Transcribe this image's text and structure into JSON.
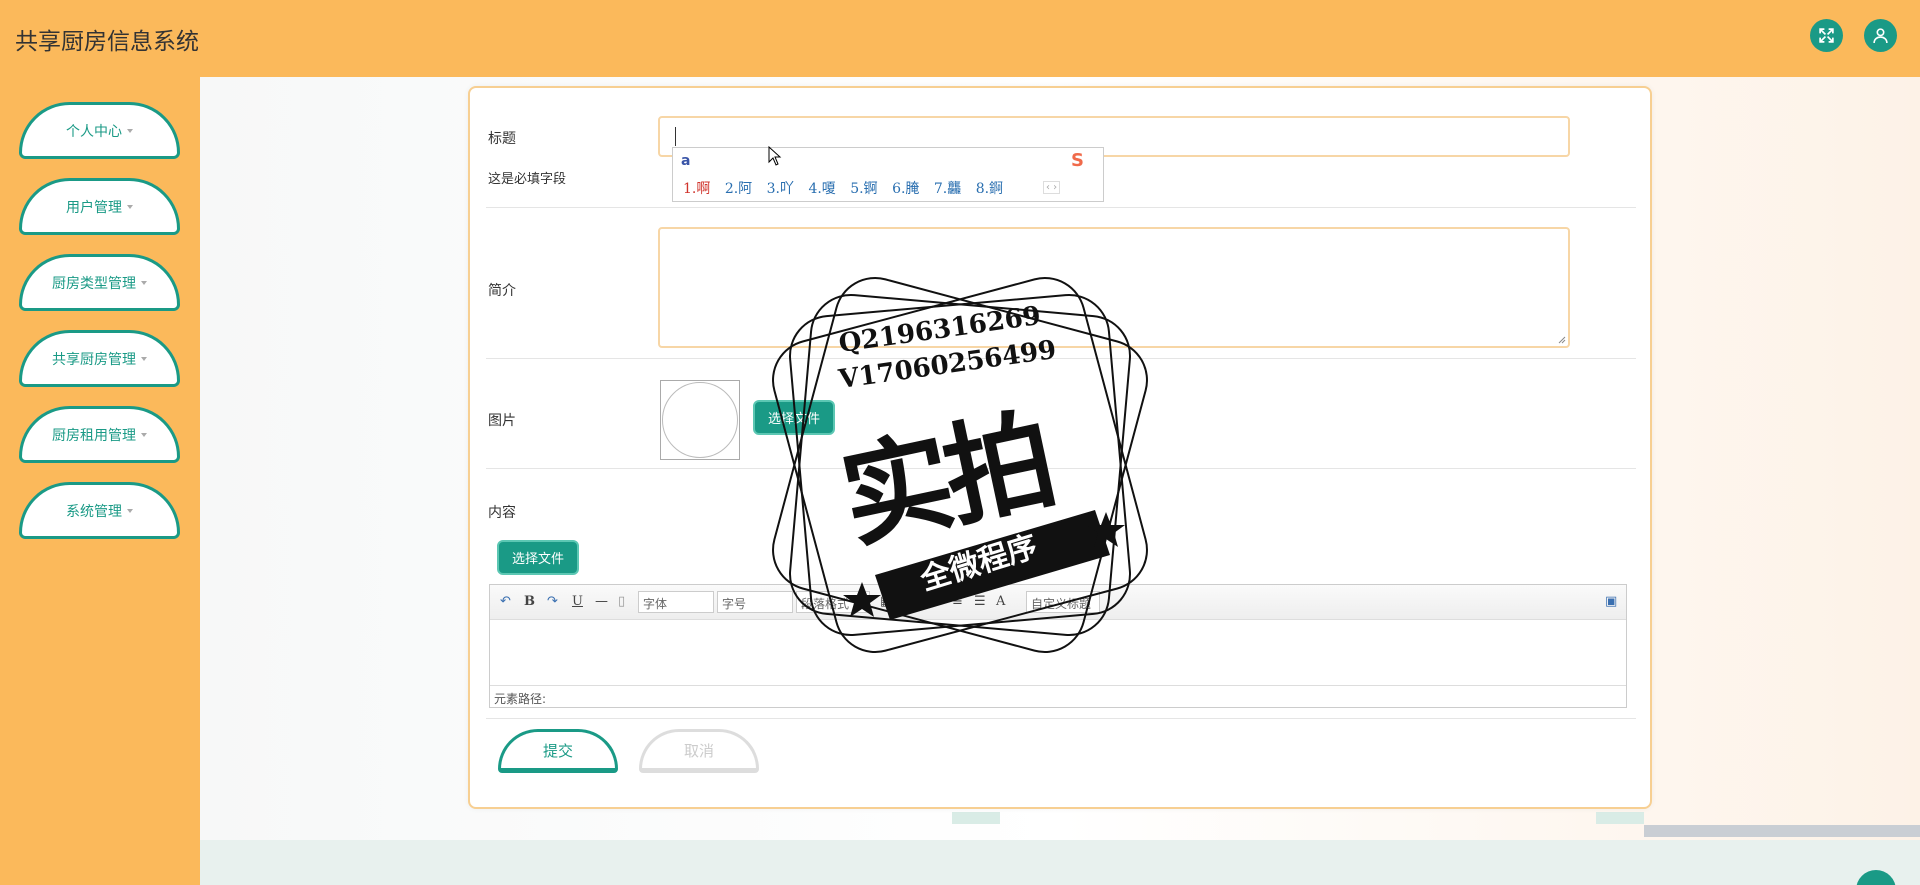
{
  "app": {
    "title": "共享厨房信息系统"
  },
  "header": {
    "fullscreen_icon": "expand-icon",
    "user_icon": "user-icon"
  },
  "sidebar": {
    "items": [
      {
        "label": "个人中心"
      },
      {
        "label": "用户管理"
      },
      {
        "label": "厨房类型管理"
      },
      {
        "label": "共享厨房管理"
      },
      {
        "label": "厨房租用管理"
      },
      {
        "label": "系统管理"
      }
    ]
  },
  "form": {
    "title_label": "标题",
    "title_value": "",
    "required_hint": "这是必填字段",
    "intro_label": "简介",
    "intro_value": "",
    "image_label": "图片",
    "choose_file": "选择文件",
    "content_label": "内容",
    "content_choose_file": "选择文件",
    "submit": "提交",
    "cancel": "取消"
  },
  "ime": {
    "input": "a",
    "candidates": [
      "1.啊",
      "2.阿",
      "3.吖",
      "4.嗄",
      "5.锕",
      "6.腌",
      "7.龘",
      "8.錒"
    ],
    "logo": "S"
  },
  "editor": {
    "font_select": "字体",
    "size_select": "字号",
    "paragraph_select": "段落格式",
    "custom_title_select": "自定义标题",
    "status_path": "元素路径:"
  },
  "watermark": {
    "line1": "Q2196316269",
    "line2": "V17060256499",
    "main": "实拍",
    "banner": "全微程序"
  }
}
